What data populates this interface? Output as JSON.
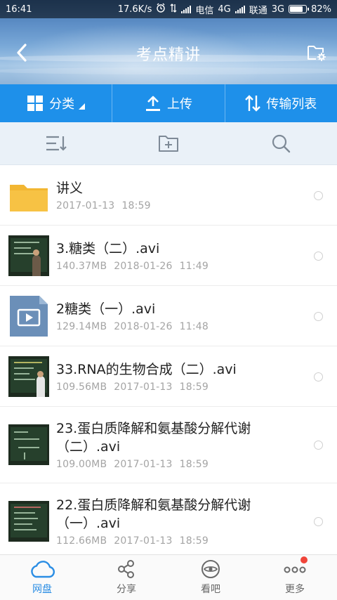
{
  "status_bar": {
    "time": "16:41",
    "speed": "17.6K/s",
    "carrier1": "电信",
    "network1": "4G",
    "carrier2": "联通",
    "network2": "3G",
    "battery_text": "82%",
    "battery_level": 0.82
  },
  "header": {
    "title": "考点精讲",
    "back_icon": "chevron-left-icon",
    "settings_icon": "folder-settings-icon"
  },
  "actions": {
    "category_label": "分类",
    "upload_label": "上传",
    "transfer_label": "传输列表"
  },
  "tools": {
    "sort_icon": "sort-list-icon",
    "new_folder_icon": "new-folder-icon",
    "search_icon": "search-icon"
  },
  "files": [
    {
      "name": "讲义",
      "size": "",
      "date": "2017-01-13",
      "time": "18:59",
      "type": "folder"
    },
    {
      "name": "3.糖类（二）.avi",
      "size": "140.37MB",
      "date": "2018-01-26",
      "time": "11:49",
      "type": "video-thumb"
    },
    {
      "name": "2糖类（一）.avi",
      "size": "129.14MB",
      "date": "2018-01-26",
      "time": "11:48",
      "type": "video-generic"
    },
    {
      "name": "33.RNA的生物合成（二）.avi",
      "size": "109.56MB",
      "date": "2017-01-13",
      "time": "18:59",
      "type": "video-thumb"
    },
    {
      "name": "23.蛋白质降解和氨基酸分解代谢（二）.avi",
      "size": "109.00MB",
      "date": "2017-01-13",
      "time": "18:59",
      "type": "video-thumb"
    },
    {
      "name": "22.蛋白质降解和氨基酸分解代谢（一）.avi",
      "size": "112.66MB",
      "date": "2017-01-13",
      "time": "18:59",
      "type": "video-thumb"
    }
  ],
  "bottom_nav": [
    {
      "label": "网盘",
      "active": true
    },
    {
      "label": "分享",
      "active": false
    },
    {
      "label": "看吧",
      "active": false
    },
    {
      "label": "更多",
      "active": false
    }
  ],
  "colors": {
    "accent": "#1e90ea",
    "active_tab": "#2a8de4",
    "badge": "#f0453a",
    "folder": "#f7c244"
  }
}
